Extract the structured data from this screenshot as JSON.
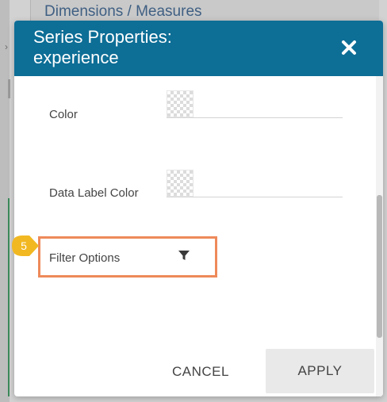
{
  "background": {
    "panel_title": "Dimensions / Measures"
  },
  "modal": {
    "title": "Series Properties:\nexperience",
    "close_icon": "close-icon",
    "fields": {
      "color_label": "Color",
      "data_label_color_label": "Data Label Color",
      "filter_options_label": "Filter Options"
    },
    "step_badge": "5",
    "buttons": {
      "cancel": "CANCEL",
      "apply": "APPLY"
    }
  },
  "colors": {
    "header": "#0d6e96",
    "highlight": "#ee8a5a",
    "badge": "#f2b822"
  }
}
